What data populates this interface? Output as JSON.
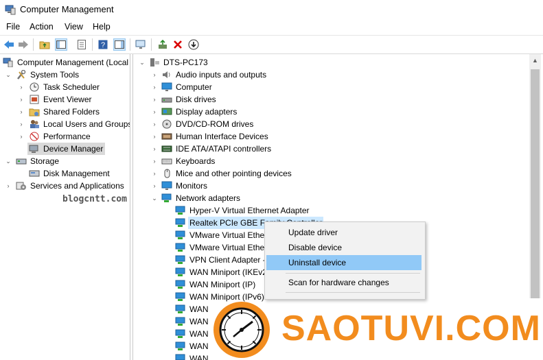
{
  "window": {
    "title": "Computer Management"
  },
  "menu": {
    "file": "File",
    "action": "Action",
    "view": "View",
    "help": "Help"
  },
  "left_tree": {
    "root": "Computer Management (Local",
    "system_tools": "System Tools",
    "task_scheduler": "Task Scheduler",
    "event_viewer": "Event Viewer",
    "shared_folders": "Shared Folders",
    "local_users": "Local Users and Groups",
    "performance": "Performance",
    "device_manager": "Device Manager",
    "storage": "Storage",
    "disk_management": "Disk Management",
    "services": "Services and Applications"
  },
  "watermark": "blogcntt.com",
  "device_tree": {
    "root": "DTS-PC173",
    "categories": [
      "Audio inputs and outputs",
      "Computer",
      "Disk drives",
      "Display adapters",
      "DVD/CD-ROM drives",
      "Human Interface Devices",
      "IDE ATA/ATAPI controllers",
      "Keyboards",
      "Mice and other pointing devices",
      "Monitors",
      "Network adapters"
    ],
    "network_adapters": [
      "Hyper-V Virtual Ethernet Adapter",
      "Realtek PCIe GBE Family Controller",
      "VMware Virtual Ether",
      "VMware Virtual Ether",
      "VPN Client Adapter -",
      "WAN Miniport (IKEv2",
      "WAN Miniport (IP)",
      "WAN Miniport (IPv6)",
      "WAN",
      "WAN",
      "WAN",
      "WAN",
      "WAN"
    ]
  },
  "context_menu": {
    "update_driver": "Update driver",
    "disable_device": "Disable device",
    "uninstall_device": "Uninstall device",
    "scan_hardware": "Scan for hardware changes"
  },
  "brand": {
    "text": "SAOTUVI.COM",
    "color": "#f28c1e"
  },
  "colors": {
    "selection": "#cce8ff",
    "menu_highlight": "#91c9f7",
    "delete_icon": "#d90000"
  }
}
